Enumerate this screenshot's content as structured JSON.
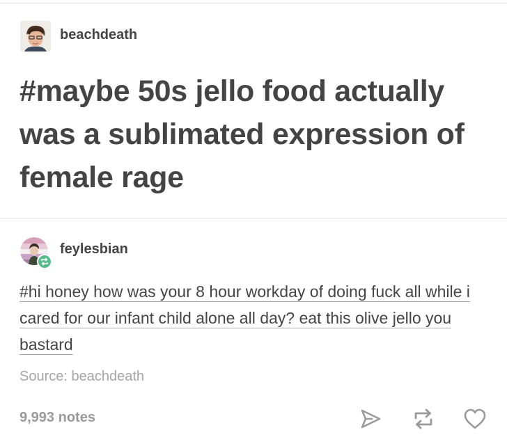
{
  "original_post": {
    "username": "beachdeath",
    "title": "#maybe 50s jello food actually was a sublimated expression of female rage",
    "avatar_icon": "user-avatar-icon"
  },
  "reblog": {
    "username": "feylesbian",
    "tag_text": "#hi honey how was your 8 hour workday of doing fuck all while i cared for our infant child alone all day? eat this olive jello you bastard",
    "source": "Source: beachdeath",
    "avatar_icon": "user-avatar-icon",
    "badge_icon": "reblog-badge-icon",
    "badge_color": "#56bc8a"
  },
  "footer": {
    "notes": "9,993 notes",
    "actions": [
      "share-icon",
      "reblog-icon",
      "heart-icon"
    ]
  },
  "colors": {
    "text": "#444444",
    "muted": "#a6a6a6",
    "icon": "#9a9a9a",
    "divider": "#e6e6e6"
  }
}
